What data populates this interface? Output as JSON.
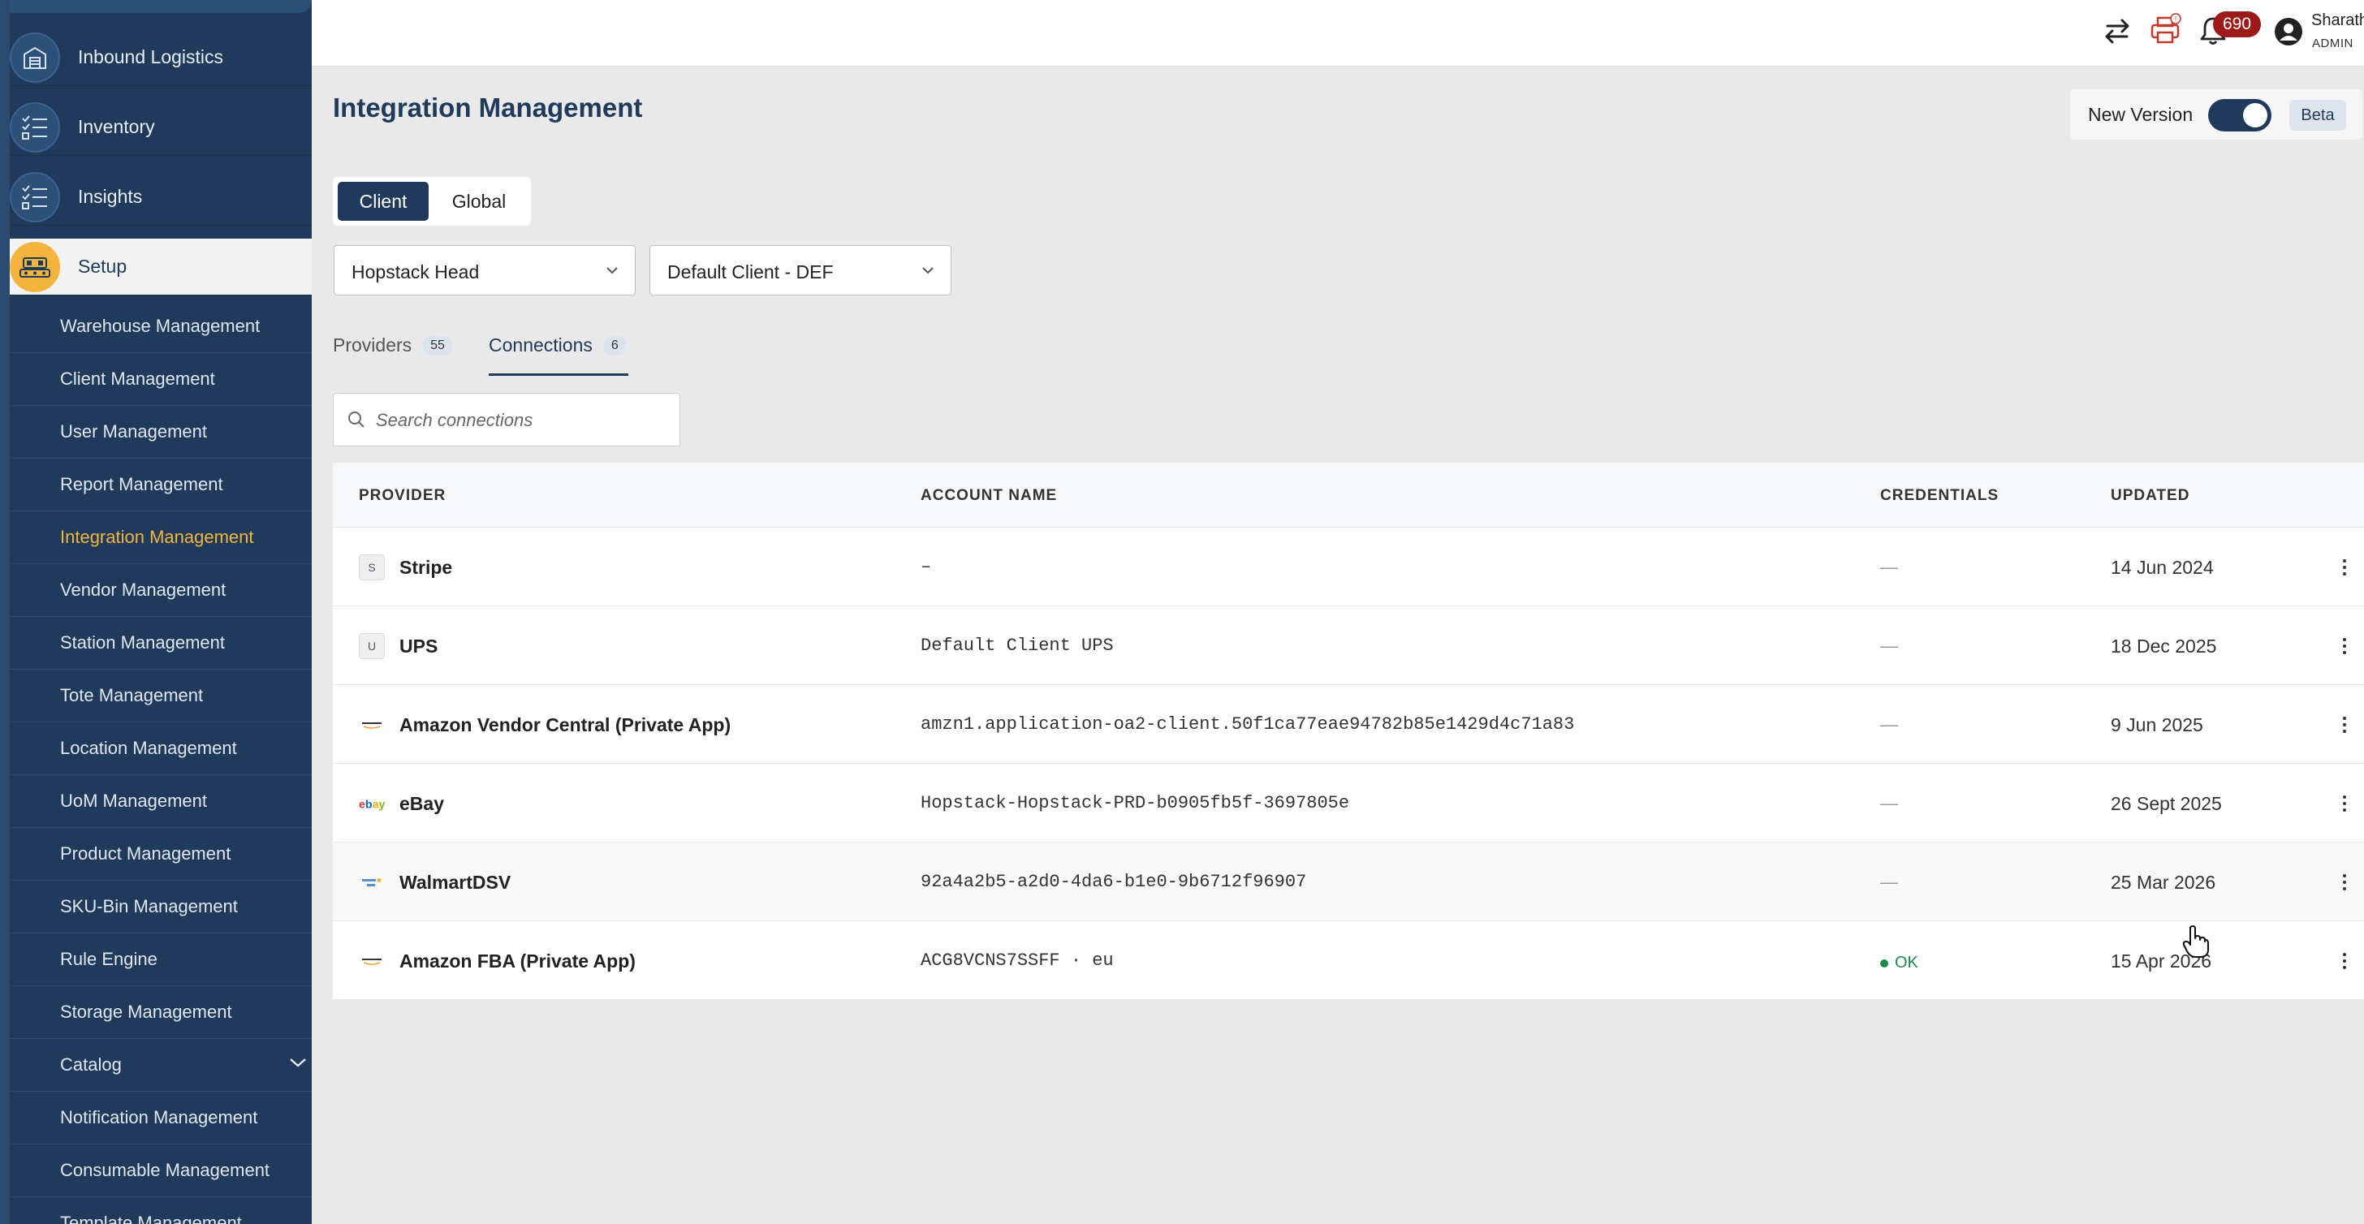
{
  "sidebar": {
    "modules": [
      {
        "label": "Inbound Logistics",
        "icon": "warehouse-icon"
      },
      {
        "label": "Inventory",
        "icon": "checklist-icon"
      },
      {
        "label": "Insights",
        "icon": "checklist-icon"
      },
      {
        "label": "Setup",
        "icon": "setup-icon",
        "active": true
      }
    ],
    "setup_items": [
      "Warehouse Management",
      "Client Management",
      "User Management",
      "Report Management",
      "Integration Management",
      "Vendor Management",
      "Station Management",
      "Tote Management",
      "Location Management",
      "UoM Management",
      "Product Management",
      "SKU-Bin Management",
      "Rule Engine",
      "Storage Management",
      "Catalog",
      "Notification Management",
      "Consumable Management",
      "Template Management"
    ],
    "active_item": "Integration Management"
  },
  "topbar": {
    "icons": [
      "swap-arrows-icon",
      "printer-icon",
      "bell-icon",
      "user-avatar-icon"
    ],
    "notification_count": "690",
    "user_name": "Sharath",
    "user_role": "ADMIN"
  },
  "page": {
    "title": "Integration Management",
    "new_version_label": "New Version",
    "new_version_enabled": true,
    "beta_label": "Beta"
  },
  "scope": {
    "client_label": "Client",
    "global_label": "Global",
    "selected": "Client"
  },
  "filters": {
    "warehouse": "Hopstack Head",
    "client": "Default Client - DEF"
  },
  "tabs": [
    {
      "label": "Providers",
      "count": "55"
    },
    {
      "label": "Connections",
      "count": "6",
      "active": true
    }
  ],
  "search": {
    "placeholder": "Search connections",
    "value": ""
  },
  "table": {
    "columns": [
      "PROVIDER",
      "ACCOUNT NAME",
      "CREDENTIALS",
      "UPDATED"
    ],
    "rows": [
      {
        "provider": "Stripe",
        "logo": "S",
        "account": "–",
        "credentials": "—",
        "updated": "14 Jun 2024"
      },
      {
        "provider": "UPS",
        "logo": "U",
        "account": "Default Client UPS",
        "credentials": "—",
        "updated": "18 Dec 2025"
      },
      {
        "provider": "Amazon Vendor Central (Private App)",
        "logo": "amazon",
        "account": "amzn1.application-oa2-client.50f1ca77eae94782b85e1429d4c71a83",
        "credentials": "—",
        "updated": "9 Jun 2025"
      },
      {
        "provider": "eBay",
        "logo": "ebay",
        "account": "Hopstack-Hopstack-PRD-b0905fb5f-3697805e",
        "credentials": "—",
        "updated": "26 Sept 2025"
      },
      {
        "provider": "WalmartDSV",
        "logo": "walmart",
        "account": "92a4a2b5-a2d0-4da6-b1e0-9b6712f96907",
        "credentials": "—",
        "updated": "25 Mar 2026"
      },
      {
        "provider": "Amazon FBA (Private App)",
        "logo": "amazon",
        "account": "ACG8VCNS7SSFF · eu",
        "credentials": "OK",
        "updated": "15 Apr 2026"
      }
    ]
  },
  "colors": {
    "sidebar_bg": "#1f3a5a",
    "accent": "#f4b53f",
    "primary": "#1f3a5a",
    "badge": "#9c1a1a",
    "ok": "#1b8a4a"
  }
}
